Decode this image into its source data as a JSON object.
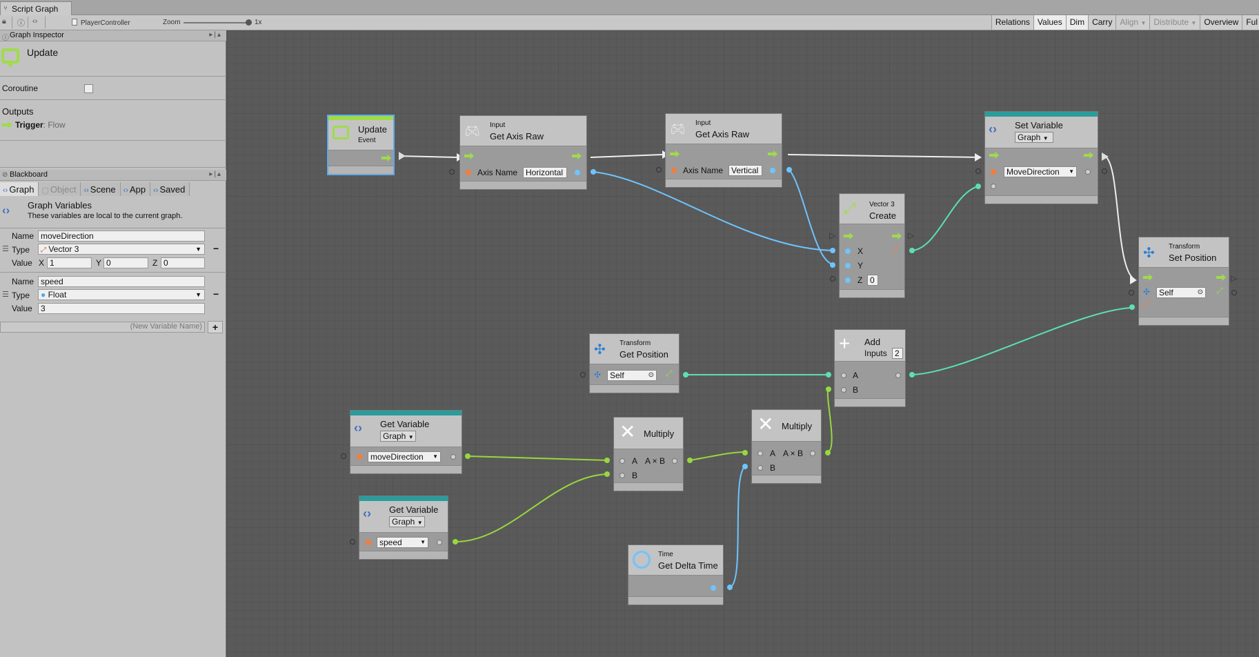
{
  "tab": {
    "title": "Script Graph"
  },
  "toolbar": {
    "breadcrumb": "PlayerController",
    "zoom_label": "Zoom",
    "zoom_value": "1x",
    "zoom_level": 1,
    "buttons": [
      "Relations",
      "Values",
      "Dim",
      "Carry",
      "Align",
      "Distribute",
      "Overview",
      "Ful"
    ]
  },
  "inspector": {
    "header": "Graph Inspector",
    "title": "Update",
    "coroutine_label": "Coroutine",
    "coroutine_checked": false,
    "outputs_label": "Outputs",
    "trigger_name": "Trigger",
    "trigger_type": ": Flow"
  },
  "blackboard": {
    "header": "Blackboard",
    "tabs": [
      "Graph",
      "Object",
      "Scene",
      "App",
      "Saved"
    ],
    "active_tab": "Graph",
    "title": "Graph Variables",
    "description": "These variables are local to the current graph.",
    "name_label": "Name",
    "type_label": "Type",
    "value_label": "Value",
    "variables": [
      {
        "name": "moveDirection",
        "type": "Vector 3",
        "x": "1",
        "y": "0",
        "z": "0"
      },
      {
        "name": "speed",
        "type": "Float",
        "value": "3"
      }
    ],
    "new_variable_placeholder": "(New Variable Name)",
    "add_symbol": "+"
  },
  "nodes": {
    "update": {
      "title": "Update",
      "subtitle": "Event"
    },
    "axis_h": {
      "surtitle": "Input",
      "title": "Get Axis Raw",
      "port_label": "Axis Name",
      "value": "Horizontal"
    },
    "axis_v": {
      "surtitle": "Input",
      "title": "Get Axis Raw",
      "port_label": "Axis Name",
      "value": "Vertical"
    },
    "vector3": {
      "surtitle": "Vector 3",
      "title": "Create",
      "x": "X",
      "y": "Y",
      "z": "Z",
      "z_value": "0"
    },
    "set_var": {
      "title": "Set Variable",
      "scope": "Graph",
      "value": "MoveDirection"
    },
    "set_pos": {
      "surtitle": "Transform",
      "title": "Set Position",
      "value": "Self"
    },
    "get_pos": {
      "surtitle": "Transform",
      "title": "Get Position",
      "value": "Self"
    },
    "add": {
      "title": "Add",
      "inputs_label": "Inputs",
      "inputs_value": "2",
      "a": "A",
      "b": "B"
    },
    "get_var1": {
      "title": "Get Variable",
      "scope": "Graph",
      "value": "moveDirection"
    },
    "get_var2": {
      "title": "Get Variable",
      "scope": "Graph",
      "value": "speed"
    },
    "mul1": {
      "title": "Multiply",
      "a": "A",
      "b": "B",
      "out": "A × B"
    },
    "mul2": {
      "title": "Multiply",
      "a": "A",
      "b": "B",
      "out": "A × B"
    },
    "delta": {
      "surtitle": "Time",
      "title": "Get Delta Time"
    }
  }
}
